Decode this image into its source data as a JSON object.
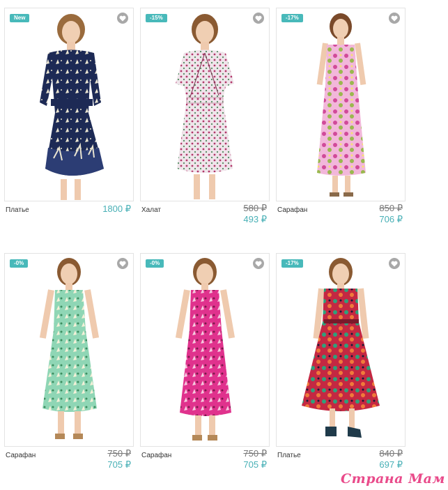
{
  "products": [
    {
      "badge": "New",
      "name": "Платье",
      "price": "1800 ₽",
      "dress": "#1d2a55",
      "pattern": "#e8e3d0",
      "style": "short-sleeve"
    },
    {
      "badge": "-15%",
      "name": "Халат",
      "old_price": "580 ₽",
      "new_price": "493 ₽",
      "dress": "#efe4ea",
      "pattern": "#b2376a",
      "style": "wrap"
    },
    {
      "badge": "-17%",
      "name": "Сарафан",
      "old_price": "850 ₽",
      "new_price": "706 ₽",
      "dress": "#f2b7da",
      "pattern": "#9ab84e",
      "style": "maxi"
    },
    {
      "badge": "-0%",
      "name": "Сарафан",
      "old_price": "750 ₽",
      "new_price": "705 ₽",
      "dress": "#8fd6b5",
      "pattern": "#3c8d5f",
      "style": "midi"
    },
    {
      "badge": "-0%",
      "name": "Сарафан",
      "old_price": "750 ₽",
      "new_price": "705 ₽",
      "dress": "#e0328d",
      "pattern": "#f4c9de",
      "style": "midi"
    },
    {
      "badge": "-17%",
      "name": "Платье",
      "old_price": "840 ₽",
      "new_price": "697 ₽",
      "dress": "#c42842",
      "pattern": "#2fa07b",
      "style": "maxi-tank"
    }
  ],
  "watermark": "Страна Мам",
  "colors": {
    "accent": "#48b9ba",
    "price": "#48b0b6",
    "heart": "#a8a8a8",
    "watermark": "#e94a8a"
  }
}
